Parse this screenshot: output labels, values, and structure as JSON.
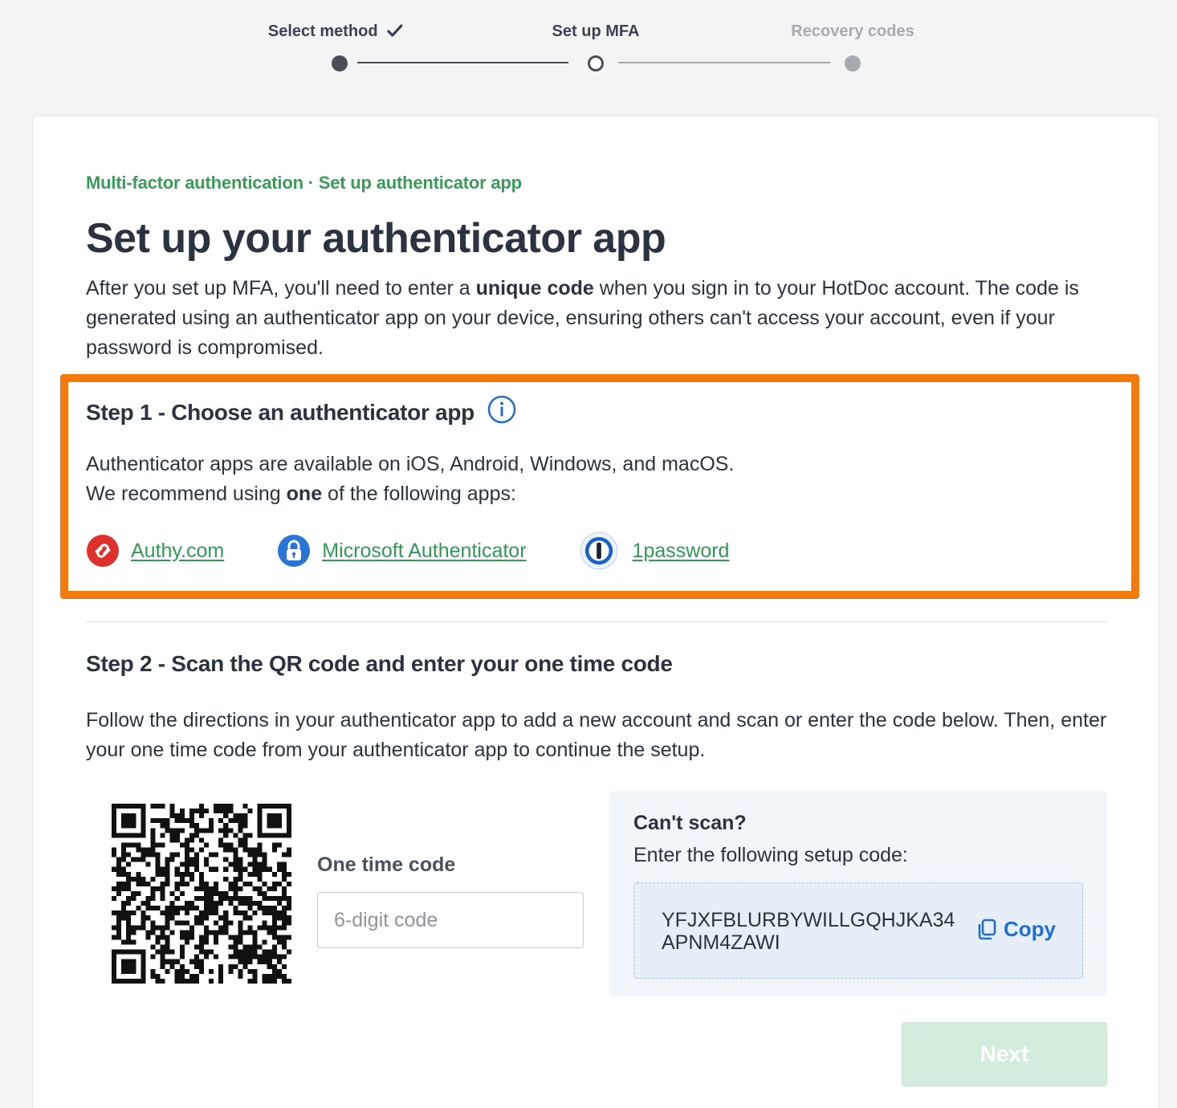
{
  "stepper": {
    "steps": [
      {
        "label": "Select method",
        "state": "done"
      },
      {
        "label": "Set up MFA",
        "state": "current"
      },
      {
        "label": "Recovery codes",
        "state": "upcoming"
      }
    ]
  },
  "breadcrumb": "Multi-factor authentication · Set up authenticator app",
  "title": "Set up your authenticator app",
  "intro": {
    "before": "After you set up MFA, you'll need to enter a ",
    "bold": "unique code",
    "after": " when you sign in to your HotDoc account. The code is generated using an authenticator app on your device, ensuring others can't access your account, even if your password is compromised."
  },
  "step1": {
    "heading": "Step 1 - Choose an authenticator app",
    "line1": "Authenticator apps are available on iOS, Android, Windows, and macOS.",
    "line2_before": "We recommend using ",
    "line2_bold": "one",
    "line2_after": " of the following apps:",
    "apps": [
      {
        "label": "Authy.com",
        "icon": "authy-icon"
      },
      {
        "label": "Microsoft Authenticator",
        "icon": "microsoft-authenticator-icon"
      },
      {
        "label": "1password",
        "icon": "1password-icon"
      }
    ]
  },
  "step2": {
    "heading": "Step 2 - Scan the QR code and enter your one time code",
    "text": "Follow the directions in your authenticator app to add a new account and scan or enter the code below. Then, enter your one time code from your authenticator app to continue the setup.",
    "otc_label": "One time code",
    "otc_placeholder": "6-digit code",
    "otc_value": "",
    "cant_scan_title": "Can't scan?",
    "cant_scan_sub": "Enter the following setup code:",
    "setup_code": "YFJXFBLURBYWILLGQHJKA34APNM4ZAWI",
    "copy_label": "Copy"
  },
  "next_label": "Next",
  "colors": {
    "accent_green": "#3a9a5a",
    "highlight_orange": "#f47a0c",
    "link_blue": "#1f6fd0",
    "next_disabled": "#d3ecdc"
  }
}
